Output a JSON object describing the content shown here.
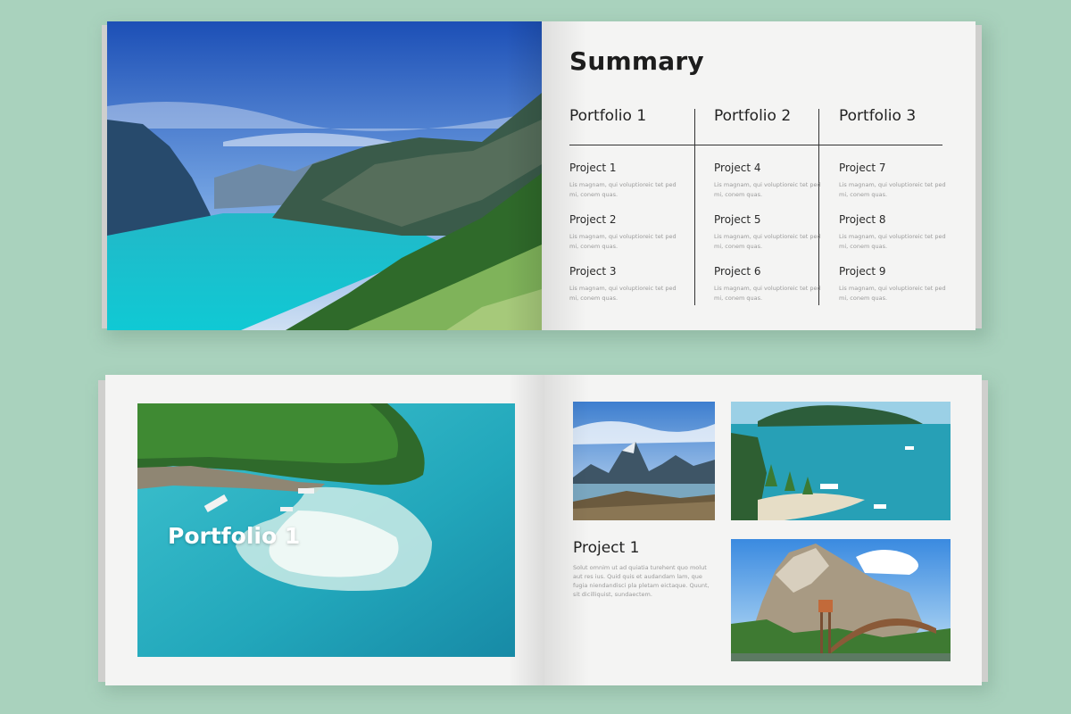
{
  "summary": {
    "title": "Summary",
    "columns": [
      {
        "heading": "Portfolio 1",
        "projects": [
          {
            "title": "Project 1",
            "desc": "Lis magnam, qui voluptioreic tet ped mi, conem quas."
          },
          {
            "title": "Project 2",
            "desc": "Lis magnam, qui voluptioreic tet ped mi, conem quas."
          },
          {
            "title": "Project 3",
            "desc": "Lis magnam, qui voluptioreic tet ped mi, conem quas."
          }
        ]
      },
      {
        "heading": "Portfolio 2",
        "projects": [
          {
            "title": "Project 4",
            "desc": "Lis magnam, qui voluptioreic tet ped mi, conem quas."
          },
          {
            "title": "Project 5",
            "desc": "Lis magnam, qui voluptioreic tet ped mi, conem quas."
          },
          {
            "title": "Project 6",
            "desc": "Lis magnam, qui voluptioreic tet ped mi, conem quas."
          }
        ]
      },
      {
        "heading": "Portfolio 3",
        "projects": [
          {
            "title": "Project 7",
            "desc": "Lis magnam, qui voluptioreic tet ped mi, conem quas."
          },
          {
            "title": "Project 8",
            "desc": "Lis magnam, qui voluptioreic tet ped mi, conem quas."
          },
          {
            "title": "Project 9",
            "desc": "Lis magnam, qui voluptioreic tet ped mi, conem quas."
          }
        ]
      }
    ]
  },
  "portfolio_page": {
    "overlay_title": "Portfolio 1",
    "project_heading": "Project 1",
    "project_body": "Solut omnim ut ad quiatia turehent quo molut aut res ius. Quid quis et audandam lam, que fugia niendandisci pla pletam eictaque. Quunt, sit dicilliquist, sundaectem."
  },
  "colors": {
    "background": "#a9d2bd",
    "paper": "#f4f4f3",
    "heading_text": "#1d1d1d",
    "muted_text": "#9a9a9a"
  }
}
